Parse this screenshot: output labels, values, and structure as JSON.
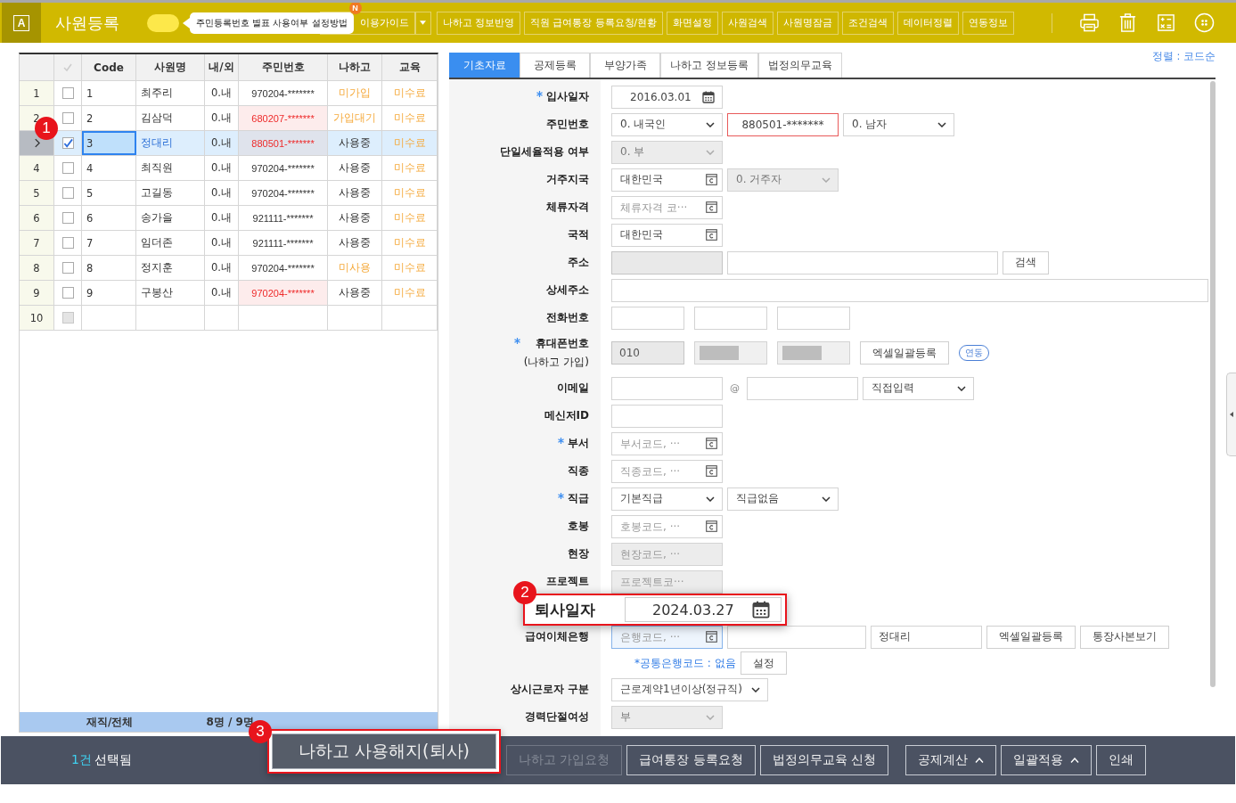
{
  "app": {
    "logo_letter": "A",
    "title": "사원등록"
  },
  "toggle": {
    "on": true
  },
  "tooltip": {
    "text": "주민등록번호 별표 사용여부 설정방법",
    "badge": "N"
  },
  "toolbar": {
    "buttons": [
      {
        "label": "이용가이드",
        "kind": "split"
      },
      {
        "label": "나하고 정보반영",
        "kind": "plain"
      },
      {
        "label": "직원 급여통장 등록요청/현황",
        "kind": "plain"
      },
      {
        "label": "화면설정",
        "kind": "plain"
      },
      {
        "label": "사원검색",
        "kind": "plain"
      },
      {
        "label": "사원명잠금",
        "kind": "plain"
      },
      {
        "label": "조건검색",
        "kind": "plain"
      },
      {
        "label": "데이터정렬",
        "kind": "plain"
      },
      {
        "label": "연동정보",
        "kind": "plain"
      }
    ]
  },
  "employee_table": {
    "columns": [
      "Code",
      "사원명",
      "내/외",
      "주민번호",
      "나하고",
      "교육"
    ],
    "rows": [
      {
        "number": "1",
        "selected": false,
        "checked": false,
        "disabled": false,
        "code": "1",
        "name": "최주리",
        "type": "0.내",
        "rrn": "970204-*******",
        "rrn_alert": false,
        "nahago": {
          "text": "미가입",
          "warning": true
        },
        "education": {
          "text": "미수료",
          "warning": true
        }
      },
      {
        "number": "2",
        "selected": false,
        "checked": false,
        "disabled": false,
        "code": "2",
        "name": "김삼덕",
        "type": "0.내",
        "rrn": "680207-*******",
        "rrn_alert": true,
        "nahago": {
          "text": "가입대기",
          "warning": true
        },
        "education": {
          "text": "미수료",
          "warning": true
        }
      },
      {
        "selected": true,
        "checked": true,
        "disabled": false,
        "code": "3",
        "name": "정대리",
        "type": "0.내",
        "rrn": "880501-*******",
        "rrn_alert": true,
        "nahago": {
          "text": "사용중",
          "warning": false
        },
        "education": {
          "text": "미수료",
          "warning": true
        }
      },
      {
        "number": "4",
        "selected": false,
        "checked": false,
        "disabled": false,
        "code": "4",
        "name": "최직원",
        "type": "0.내",
        "rrn": "970204-*******",
        "rrn_alert": false,
        "nahago": {
          "text": "사용중",
          "warning": false
        },
        "education": {
          "text": "미수료",
          "warning": true
        }
      },
      {
        "number": "5",
        "selected": false,
        "checked": false,
        "disabled": false,
        "code": "5",
        "name": "고길동",
        "type": "0.내",
        "rrn": "970204-*******",
        "rrn_alert": false,
        "nahago": {
          "text": "사용중",
          "warning": false
        },
        "education": {
          "text": "미수료",
          "warning": true
        }
      },
      {
        "number": "6",
        "selected": false,
        "checked": false,
        "disabled": false,
        "code": "6",
        "name": "송가을",
        "type": "0.내",
        "rrn": "921111-*******",
        "rrn_alert": false,
        "nahago": {
          "text": "사용중",
          "warning": false
        },
        "education": {
          "text": "미수료",
          "warning": true
        }
      },
      {
        "number": "7",
        "selected": false,
        "checked": false,
        "disabled": false,
        "code": "7",
        "name": "임더존",
        "type": "0.내",
        "rrn": "921111-*******",
        "rrn_alert": false,
        "nahago": {
          "text": "사용중",
          "warning": false
        },
        "education": {
          "text": "미수료",
          "warning": true
        }
      },
      {
        "number": "8",
        "selected": false,
        "checked": false,
        "disabled": false,
        "code": "8",
        "name": "정지훈",
        "type": "0.내",
        "rrn": "970204-*******",
        "rrn_alert": false,
        "nahago": {
          "text": "미사용",
          "warning": true
        },
        "education": {
          "text": "미수료",
          "warning": true
        }
      },
      {
        "number": "9",
        "selected": false,
        "checked": false,
        "disabled": false,
        "code": "9",
        "name": "구봉산",
        "type": "0.내",
        "rrn": "970204-*******",
        "rrn_alert": true,
        "nahago": {
          "text": "사용중",
          "warning": false
        },
        "education": {
          "text": "미수료",
          "warning": true
        }
      },
      {
        "number": "10",
        "selected": false,
        "checked": false,
        "disabled": true
      }
    ],
    "footer": {
      "label": "재직/전체",
      "count": "8명 / 9명"
    }
  },
  "tabs": [
    {
      "label": "기초자료",
      "selected": true
    },
    {
      "label": "공제등록",
      "selected": false
    },
    {
      "label": "부양가족",
      "selected": false
    },
    {
      "label": "나하고 정보등록",
      "selected": false
    },
    {
      "label": "법정의무교육",
      "selected": false
    }
  ],
  "sort_label": "정렬 : 코드순",
  "form": {
    "rows": [
      {
        "kind": "field",
        "label": "입사일자",
        "required": true,
        "fields": [
          {
            "kind": "date",
            "value": "2016.03.01"
          }
        ]
      },
      {
        "kind": "field",
        "label": "주민번호",
        "required": false,
        "fields": [
          {
            "kind": "select",
            "value": "0. 내국인",
            "disabled": false
          },
          {
            "kind": "text",
            "value": "880501-*******",
            "alert": true,
            "disabled": false
          },
          {
            "kind": "select",
            "value": "0. 남자",
            "disabled": false
          }
        ]
      },
      {
        "kind": "field",
        "label": "단일세율적용 여부",
        "required": false,
        "fields": [
          {
            "kind": "select",
            "value": "0. 부",
            "disabled": true
          }
        ]
      },
      {
        "kind": "field",
        "label": "거주지국",
        "required": false,
        "fields": [
          {
            "kind": "lookup",
            "value": "대한민국",
            "disabled": false,
            "focused": false
          },
          {
            "kind": "select",
            "value": "0. 거주자",
            "disabled": true
          }
        ]
      },
      {
        "kind": "field",
        "label": "체류자격",
        "required": false,
        "fields": [
          {
            "kind": "lookup",
            "placeholder": "체류자격 코···",
            "disabled": false,
            "focused": false
          }
        ]
      },
      {
        "kind": "field",
        "label": "국적",
        "required": false,
        "fields": [
          {
            "kind": "lookup",
            "value": "대한민국",
            "disabled": false,
            "focused": false
          }
        ]
      },
      {
        "kind": "field",
        "label": "주소",
        "required": false,
        "fields": [
          {
            "kind": "text",
            "disabled": true,
            "alert": false
          },
          {
            "kind": "long-text",
            "disabled": false,
            "alert": false
          },
          {
            "kind": "button",
            "label": "검색"
          }
        ]
      },
      {
        "kind": "field",
        "label": "상세주소",
        "required": false,
        "fields": [
          {
            "kind": "full-text",
            "disabled": false,
            "alert": false
          }
        ]
      },
      {
        "kind": "field",
        "label": "전화번호",
        "required": false,
        "fields": [
          {
            "kind": "short-text",
            "disabled": false,
            "alert": false
          },
          {
            "kind": "short-text",
            "disabled": false,
            "alert": false
          },
          {
            "kind": "short-text",
            "disabled": false,
            "alert": false
          }
        ]
      },
      {
        "kind": "field",
        "label": "휴대폰번호",
        "sublabel": "(나하고 가입)",
        "required": true,
        "fields": [
          {
            "kind": "short-text",
            "value": "010",
            "disabled": true,
            "alert": false
          },
          {
            "kind": "masked"
          },
          {
            "kind": "masked"
          },
          {
            "kind": "button",
            "label": "엑셀일괄등록"
          },
          {
            "kind": "badge",
            "label": "연동"
          }
        ]
      },
      {
        "kind": "field",
        "label": "이메일",
        "required": false,
        "fields": [
          {
            "kind": "text",
            "disabled": false,
            "alert": false
          },
          {
            "kind": "at",
            "text": "@"
          },
          {
            "kind": "text",
            "disabled": false,
            "alert": false
          },
          {
            "kind": "select",
            "value": "직접입력",
            "disabled": false
          }
        ]
      },
      {
        "kind": "field",
        "label": "메신저ID",
        "required": false,
        "fields": [
          {
            "kind": "text",
            "disabled": false,
            "alert": false
          }
        ]
      },
      {
        "kind": "field",
        "label": "부서",
        "required": true,
        "fields": [
          {
            "kind": "lookup",
            "placeholder": "부서코드, ···",
            "disabled": false,
            "focused": false
          }
        ]
      },
      {
        "kind": "field",
        "label": "직종",
        "required": false,
        "fields": [
          {
            "kind": "lookup",
            "placeholder": "직종코드, ···",
            "disabled": false,
            "focused": false
          }
        ]
      },
      {
        "kind": "field",
        "label": "직급",
        "required": true,
        "fields": [
          {
            "kind": "select",
            "value": "기본직급",
            "disabled": false
          },
          {
            "kind": "select",
            "value": "직급없음",
            "disabled": false
          }
        ]
      },
      {
        "kind": "field",
        "label": "호봉",
        "required": false,
        "fields": [
          {
            "kind": "lookup",
            "placeholder": "호봉코드, ···",
            "disabled": false,
            "focused": false
          }
        ]
      },
      {
        "kind": "field",
        "label": "현장",
        "required": false,
        "fields": [
          {
            "kind": "lookup",
            "placeholder": "현장코드, ···",
            "disabled": true,
            "focused": false
          }
        ]
      },
      {
        "kind": "field",
        "label": "프로젝트",
        "required": false,
        "fields": [
          {
            "kind": "lookup",
            "placeholder": "프로젝트코···",
            "disabled": true,
            "focused": false
          }
        ]
      },
      {
        "kind": "callout",
        "badge": "2",
        "label": "퇴사일자",
        "fields": [
          {
            "kind": "date",
            "value": "2024.03.27"
          }
        ]
      },
      {
        "kind": "field",
        "label": "급여이체은행",
        "required": false,
        "fields": [
          {
            "kind": "lookup",
            "placeholder": "은행코드, ···",
            "disabled": false,
            "focused": true
          },
          {
            "kind": "wide-text",
            "disabled": false,
            "alert": false
          },
          {
            "kind": "text",
            "value": "정대리",
            "disabled": false,
            "alert": false
          },
          {
            "kind": "button",
            "label": "엑셀일괄등록"
          },
          {
            "kind": "button",
            "label": "통장사본보기"
          }
        ]
      },
      {
        "kind": "note",
        "link": "*공통은행코드 : 없음",
        "button": "설정"
      },
      {
        "kind": "field",
        "label": "상시근로자 구분",
        "required": false,
        "fields": [
          {
            "kind": "select",
            "value": "근로계약1년이상(정규직)",
            "disabled": false
          }
        ]
      },
      {
        "kind": "field",
        "label": "경력단절여성",
        "required": false,
        "fields": [
          {
            "kind": "select",
            "value": "부",
            "disabled": true
          }
        ]
      }
    ]
  },
  "status": {
    "count": "1건",
    "text": "선택됨"
  },
  "bottom_buttons": [
    {
      "label": "나하고 가입요청",
      "disabled": true,
      "dropup": false
    },
    {
      "label": "급여통장 등록요청",
      "disabled": false,
      "dropup": false
    },
    {
      "label": "법정의무교육 신청",
      "disabled": false,
      "dropup": false
    },
    {
      "label": "공제계산",
      "disabled": false,
      "dropup": true
    },
    {
      "label": "일괄적용",
      "disabled": false,
      "dropup": true
    },
    {
      "label": "인쇄",
      "disabled": false,
      "dropup": false
    }
  ],
  "callouts": [
    {
      "badge": "1"
    },
    {
      "badge": "3",
      "label": "나하고 사용해지(퇴사)"
    }
  ]
}
